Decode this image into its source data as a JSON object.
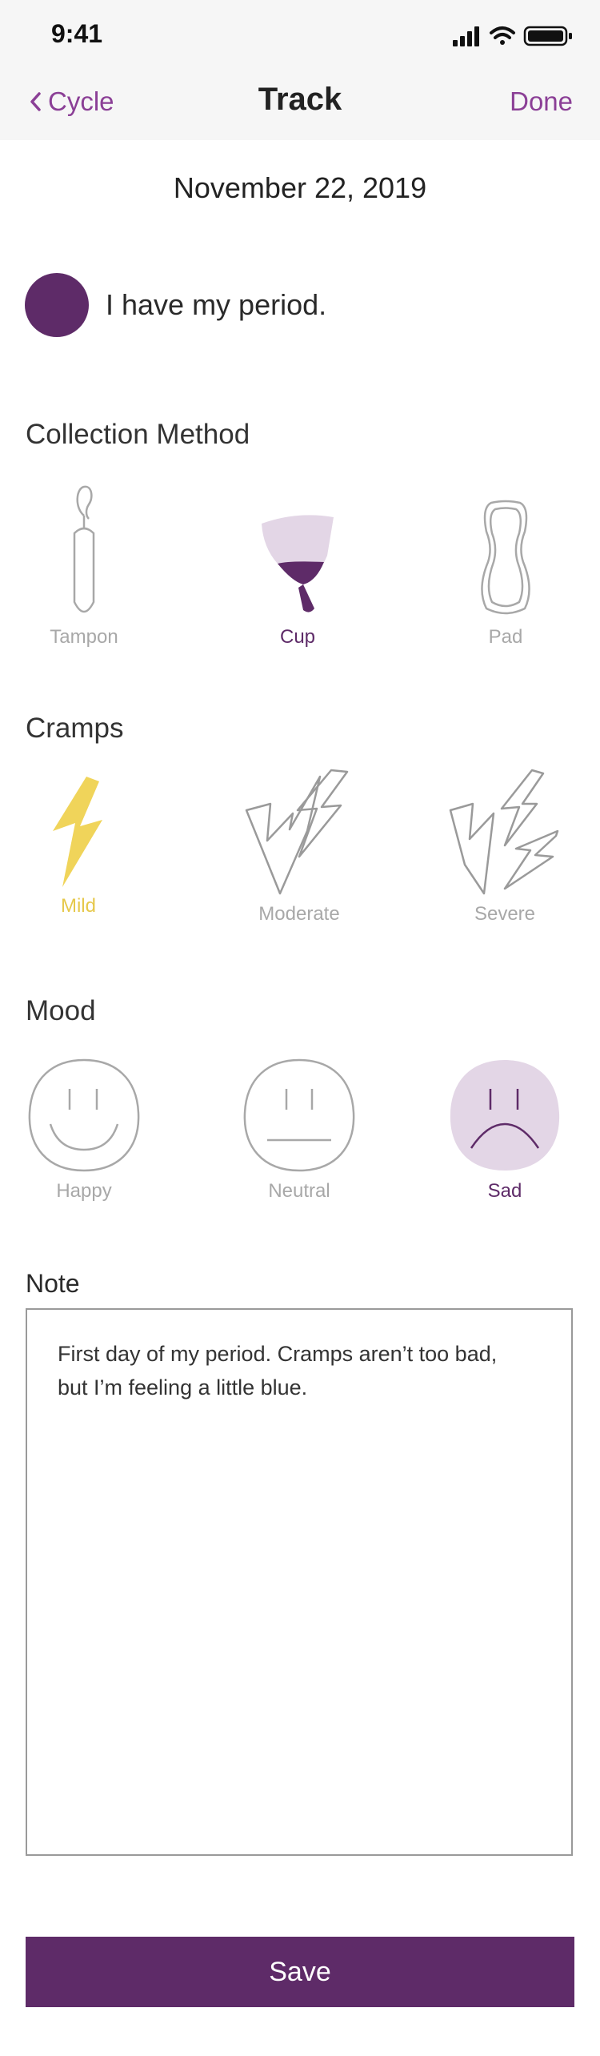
{
  "status_bar": {
    "time": "9:41",
    "icons": [
      "signal-icon",
      "wifi-icon",
      "battery-icon"
    ]
  },
  "nav": {
    "back_label": "Cycle",
    "title": "Track",
    "done_label": "Done"
  },
  "date": "November 22, 2019",
  "period": {
    "label": "I have my period.",
    "checked": true
  },
  "collection": {
    "title": "Collection Method",
    "options": [
      {
        "label": "Tampon",
        "icon": "tampon-icon",
        "selected": false
      },
      {
        "label": "Cup",
        "icon": "menstrual-cup-icon",
        "selected": true
      },
      {
        "label": "Pad",
        "icon": "pad-icon",
        "selected": false
      }
    ]
  },
  "cramps": {
    "title": "Cramps",
    "options": [
      {
        "label": "Mild",
        "icon": "lightning-single-icon",
        "selected": true
      },
      {
        "label": "Moderate",
        "icon": "lightning-double-icon",
        "selected": false
      },
      {
        "label": "Severe",
        "icon": "lightning-triple-icon",
        "selected": false
      }
    ]
  },
  "mood": {
    "title": "Mood",
    "options": [
      {
        "label": "Happy",
        "icon": "happy-face-icon",
        "selected": false
      },
      {
        "label": "Neutral",
        "icon": "neutral-face-icon",
        "selected": false
      },
      {
        "label": "Sad",
        "icon": "sad-face-icon",
        "selected": true
      }
    ]
  },
  "note": {
    "title": "Note",
    "text": "First day of my period. Cramps aren’t too bad,\nbut I’m feeling a little blue."
  },
  "save_label": "Save",
  "colors": {
    "accent": "#8b3f96",
    "primary": "#5e2b68",
    "selected_light": "#e3d6e6",
    "mild_yellow": "#f0d45a",
    "muted": "#a8a8a8"
  }
}
